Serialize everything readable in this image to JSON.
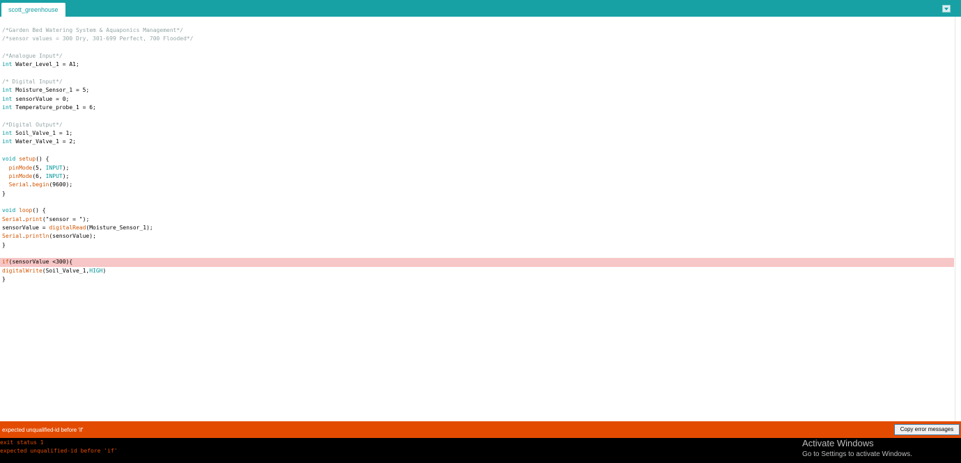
{
  "tabs": [
    {
      "label": "scott_greenhouse",
      "active": true
    }
  ],
  "tab_menu_icon": "chevron-down-icon",
  "code_lines": [
    {
      "html": "<span class='c'>/*Garden Bed Watering System &amp; Aquaponics Management*/</span>"
    },
    {
      "html": "<span class='c'>/*sensor values = 300 Dry, 301-699 Perfect, 700 Flooded*/</span>"
    },
    {
      "html": ""
    },
    {
      "html": "<span class='c'>/*Analogue Input*/</span>"
    },
    {
      "html": "<span class='t'>int</span> Water_Level_1 = A1;"
    },
    {
      "html": ""
    },
    {
      "html": "<span class='c'>/* Digital Input*/</span>"
    },
    {
      "html": "<span class='t'>int</span> Moisture_Sensor_1 = 5;"
    },
    {
      "html": "<span class='t'>int</span> sensorValue = 0;"
    },
    {
      "html": "<span class='t'>int</span> Temperature_probe_1 = 6;"
    },
    {
      "html": ""
    },
    {
      "html": "<span class='c'>/*Digital Output*/</span>"
    },
    {
      "html": "<span class='t'>int</span> Soil_Valve_1 = 1;"
    },
    {
      "html": "<span class='t'>int</span> Water_Valve_1 = 2;"
    },
    {
      "html": ""
    },
    {
      "html": "<span class='t'>void</span> <span class='f'>setup</span>() {"
    },
    {
      "html": "  <span class='f'>pinMode</span>(5, <span class='k'>INPUT</span>);"
    },
    {
      "html": "  <span class='f'>pinMode</span>(6, <span class='k'>INPUT</span>);"
    },
    {
      "html": "  <span class='f'>Serial</span>.<span class='f'>begin</span>(9600);"
    },
    {
      "html": "}"
    },
    {
      "html": ""
    },
    {
      "html": "<span class='t'>void</span> <span class='f'>loop</span>() {"
    },
    {
      "html": "<span class='f'>Serial</span>.<span class='f'>print</span>(\"sensor = \");"
    },
    {
      "html": "sensorValue = <span class='f'>digitalRead</span>(Moisture_Sensor_1);"
    },
    {
      "html": "<span class='f'>Serial</span>.<span class='f'>println</span>(sensorValue);"
    },
    {
      "html": "}"
    },
    {
      "html": ""
    },
    {
      "html": "<span class='f'>if</span>(sensorValue &lt;300){",
      "error": true
    },
    {
      "html": "<span class='f'>digitalWrite</span>(Soil_Valve_1,<span class='k'>HIGH</span>)"
    },
    {
      "html": "}"
    }
  ],
  "status": {
    "message": "expected unqualified-id before 'if'",
    "copy_button": "Copy error messages"
  },
  "console": {
    "lines": [
      "exit status 1",
      "expected unqualified-id before 'if'"
    ]
  },
  "watermark": {
    "title": "Activate Windows",
    "subtitle": "Go to Settings to activate Windows."
  },
  "colors": {
    "teal": "#17a1a5",
    "error_bar": "#e34c00",
    "error_highlight": "#f7c6c6",
    "console_bg": "#000000"
  }
}
